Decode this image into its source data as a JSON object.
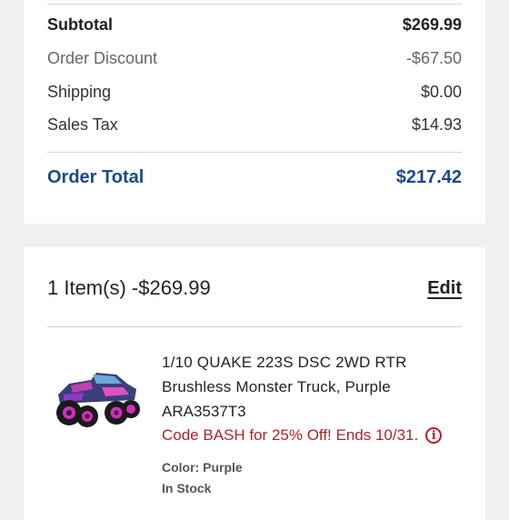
{
  "summary": {
    "subtotal": {
      "label": "Subtotal",
      "value": "$269.99"
    },
    "discount": {
      "label": "Order Discount",
      "value": "-$67.50"
    },
    "shipping": {
      "label": "Shipping",
      "value": "$0.00"
    },
    "tax": {
      "label": "Sales Tax",
      "value": "$14.93"
    },
    "total": {
      "label": "Order Total",
      "value": "$217.42"
    }
  },
  "items": {
    "title": "1 Item(s) -$269.99",
    "edit_label": "Edit",
    "product": {
      "name": "1/10 QUAKE 223S DSC 2WD RTR Brushless Monster Truck, Purple",
      "sku": "ARA3537T3",
      "promo": "Code BASH for 25% Off! Ends 10/31.",
      "info_icon": "info-icon",
      "color": "Color: Purple",
      "stock": "In Stock"
    }
  },
  "colors": {
    "accent": "#1a4a8c",
    "promo": "#b3202a"
  }
}
